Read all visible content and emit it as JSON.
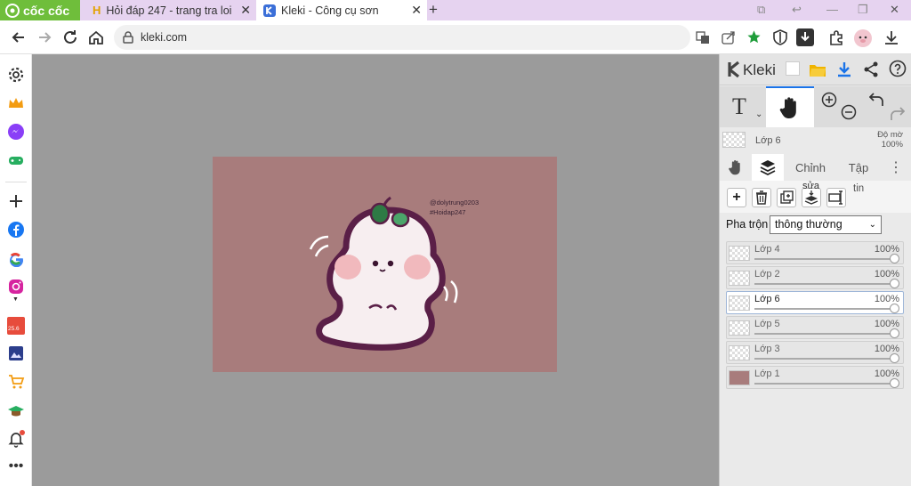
{
  "browser": {
    "brand": "cốc cốc",
    "tabs": [
      {
        "title": "Hỏi đáp 247 - trang tra loi",
        "active": false
      },
      {
        "title": "Kleki - Công cụ sơn",
        "active": true
      }
    ],
    "url": "kleki.com"
  },
  "sidebar": {
    "icons": [
      "settings-icon",
      "crown-icon",
      "messenger-icon",
      "gamepad-icon",
      "plus-icon",
      "facebook-icon",
      "google-icon",
      "instagram-icon",
      "calendar-icon",
      "app-icon",
      "cart-icon",
      "hat-icon",
      "bell-icon",
      "more-icon"
    ],
    "calendar_label": "25.6"
  },
  "canvas": {
    "background": "#a87c7c",
    "watermark_line1": "@dolytrung0203",
    "watermark_line2": "#Hoidap247"
  },
  "panel": {
    "app_name": "Kleki",
    "current_layer": {
      "name": "Lớp 6",
      "opacity_label": "Độ mờ",
      "opacity": "100%"
    },
    "tabs": [
      "Chỉnh",
      "Tập"
    ],
    "layer_btn_labels": [
      "sửa",
      "tin"
    ],
    "blend_label": "Pha trộn",
    "blend_mode": "thông thường",
    "layers": [
      {
        "name": "Lớp 4",
        "opacity": "100%",
        "selected": false
      },
      {
        "name": "Lớp 2",
        "opacity": "100%",
        "selected": false
      },
      {
        "name": "Lớp 6",
        "opacity": "100%",
        "selected": true
      },
      {
        "name": "Lớp 5",
        "opacity": "100%",
        "selected": false
      },
      {
        "name": "Lớp 3",
        "opacity": "100%",
        "selected": false
      },
      {
        "name": "Lớp 1",
        "opacity": "100%",
        "selected": false
      }
    ]
  },
  "colors": {
    "accent": "#1a73e8",
    "brand_green": "#6fbe3b",
    "layer1_fill": "#a87c7c"
  }
}
